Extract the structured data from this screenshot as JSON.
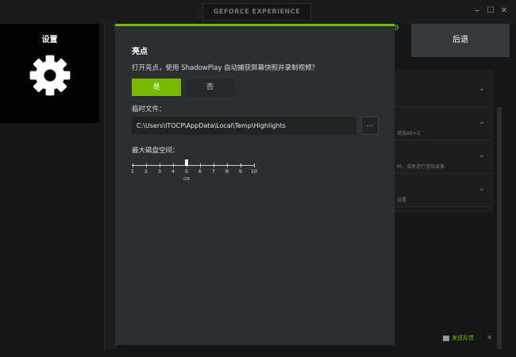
{
  "window": {
    "app_title": "GEFORCE EXPERIENCE",
    "controls": [
      "⎯",
      "☐",
      "✕"
    ]
  },
  "settings_tile": {
    "title": "设置",
    "icon": "gear-icon"
  },
  "back_button": {
    "label": "后退"
  },
  "background": {
    "rows": [
      {
        "sub": ""
      },
      {
        "sub": "请按Alt+Z"
      },
      {
        "sub": "吗，或者进行游戏录像"
      },
      {
        "sub": "设置"
      }
    ],
    "feedback_label": "发送反馈"
  },
  "dialog": {
    "title": "亮点",
    "question": "打开亮点，使用 ShadowPlay 自动捕获屏幕快照并录制视频？",
    "yes_label": "是",
    "no_label": "否",
    "temp_files_label": "临时文件：",
    "temp_path": "C:\\Users\\ITOCP\\AppData\\Local\\Temp\\Highlights",
    "browse_label": "...",
    "max_disk_label": "最大磁盘空间：",
    "slider": {
      "min": 1,
      "max": 10,
      "value": 5,
      "ticks": [
        "1",
        "2",
        "3",
        "4",
        "5",
        "6",
        "7",
        "8",
        "9",
        "10"
      ],
      "unit": "GB"
    }
  },
  "colors": {
    "accent": "#76b900",
    "dialog_bg": "#2b2f31",
    "back_bg": "#35393b"
  }
}
